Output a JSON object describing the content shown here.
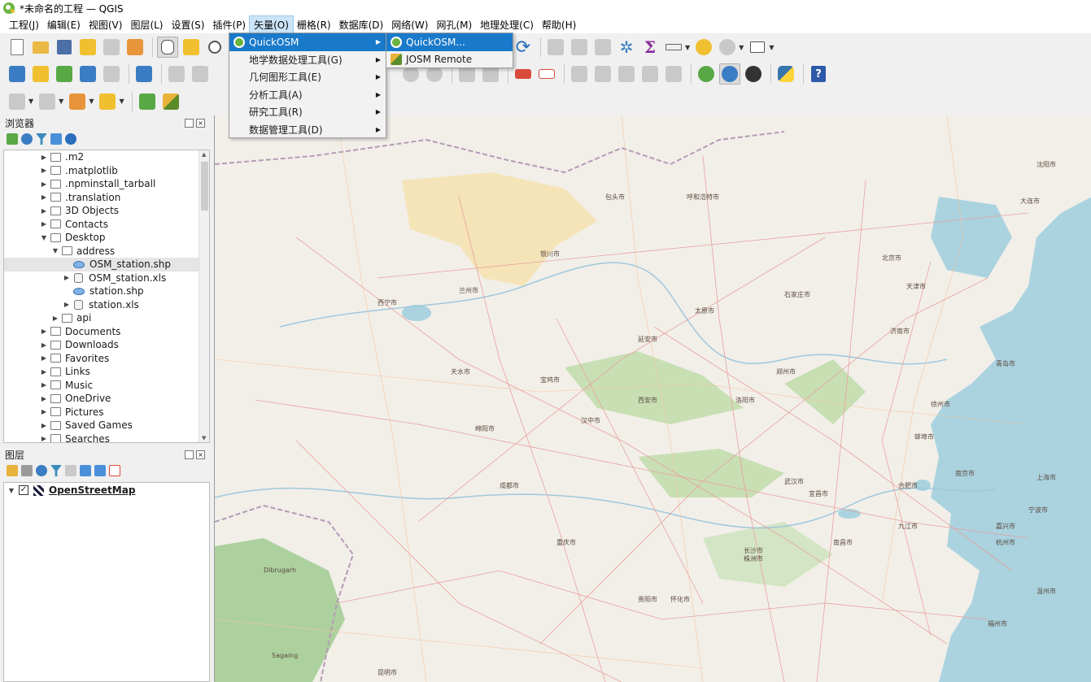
{
  "window": {
    "title": "*未命名的工程 — QGIS"
  },
  "menubar": {
    "items": [
      "工程(J)",
      "编辑(E)",
      "视图(V)",
      "图层(L)",
      "设置(S)",
      "插件(P)",
      "矢量(O)",
      "栅格(R)",
      "数据库(D)",
      "网络(W)",
      "网孔(M)",
      "地理处理(C)",
      "帮助(H)"
    ],
    "active_index": 6
  },
  "vector_menu": {
    "items": [
      {
        "label": "QuickOSM",
        "submenu": true,
        "highlighted": true
      },
      {
        "label": "地学数据处理工具(G)",
        "submenu": true
      },
      {
        "label": "几何图形工具(E)",
        "submenu": true
      },
      {
        "label": "分析工具(A)",
        "submenu": true
      },
      {
        "label": "研究工具(R)",
        "submenu": true
      },
      {
        "label": "数据管理工具(D)",
        "submenu": true
      }
    ]
  },
  "quickosm_submenu": {
    "items": [
      {
        "label": "QuickOSM...",
        "highlighted": true,
        "icon": "quickosm-icon"
      },
      {
        "label": "JOSM Remote",
        "icon": "josm-icon"
      }
    ]
  },
  "browser": {
    "title": "浏览器",
    "tree": [
      {
        "label": ".m2",
        "type": "folder",
        "depth": 0,
        "expanded": false
      },
      {
        "label": ".matplotlib",
        "type": "folder",
        "depth": 0,
        "expanded": false
      },
      {
        "label": ".npminstall_tarball",
        "type": "folder",
        "depth": 0,
        "expanded": false
      },
      {
        "label": ".translation",
        "type": "folder",
        "depth": 0,
        "expanded": false
      },
      {
        "label": "3D Objects",
        "type": "folder",
        "depth": 0,
        "expanded": false
      },
      {
        "label": "Contacts",
        "type": "folder",
        "depth": 0,
        "expanded": false
      },
      {
        "label": "Desktop",
        "type": "folder",
        "depth": 0,
        "expanded": true
      },
      {
        "label": "address",
        "type": "folder",
        "depth": 1,
        "expanded": true
      },
      {
        "label": "OSM_station.shp",
        "type": "shp",
        "depth": 2,
        "selected": true
      },
      {
        "label": "OSM_station.xls",
        "type": "db",
        "depth": 2,
        "expanded": false
      },
      {
        "label": "station.shp",
        "type": "shp",
        "depth": 2
      },
      {
        "label": "station.xls",
        "type": "db",
        "depth": 2,
        "expanded": false
      },
      {
        "label": "api",
        "type": "folder",
        "depth": 1,
        "expanded": false
      },
      {
        "label": "Documents",
        "type": "folder",
        "depth": 0,
        "expanded": false
      },
      {
        "label": "Downloads",
        "type": "folder",
        "depth": 0,
        "expanded": false
      },
      {
        "label": "Favorites",
        "type": "folder",
        "depth": 0,
        "expanded": false
      },
      {
        "label": "Links",
        "type": "folder",
        "depth": 0,
        "expanded": false
      },
      {
        "label": "Music",
        "type": "folder",
        "depth": 0,
        "expanded": false
      },
      {
        "label": "OneDrive",
        "type": "folder",
        "depth": 0,
        "expanded": false
      },
      {
        "label": "Pictures",
        "type": "folder",
        "depth": 0,
        "expanded": false
      },
      {
        "label": "Saved Games",
        "type": "folder",
        "depth": 0,
        "expanded": false
      },
      {
        "label": "Searches",
        "type": "folder",
        "depth": 0,
        "expanded": false
      }
    ]
  },
  "layers": {
    "title": "图层",
    "items": [
      {
        "label": "OpenStreetMap",
        "checked": true
      }
    ]
  },
  "map_labels": [
    {
      "text": "北京市"
    },
    {
      "text": "天津市"
    },
    {
      "text": "石家庄市"
    },
    {
      "text": "太原市"
    },
    {
      "text": "济南市"
    },
    {
      "text": "郑州市"
    },
    {
      "text": "西安市"
    },
    {
      "text": "兰州市"
    },
    {
      "text": "银川市"
    },
    {
      "text": "呼和浩特市"
    },
    {
      "text": "武汉市"
    },
    {
      "text": "南京市"
    },
    {
      "text": "上海市"
    },
    {
      "text": "杭州市"
    },
    {
      "text": "合肥市"
    },
    {
      "text": "成都市"
    },
    {
      "text": "重庆市"
    },
    {
      "text": "长沙市"
    },
    {
      "text": "南昌市"
    },
    {
      "text": "贵阳市"
    },
    {
      "text": "福州市"
    },
    {
      "text": "青岛市"
    },
    {
      "text": "大连市"
    },
    {
      "text": "沈阳市"
    },
    {
      "text": "西宁市"
    },
    {
      "text": "包头市"
    },
    {
      "text": "洛阳市"
    },
    {
      "text": "宜昌市"
    },
    {
      "text": "徐州市"
    },
    {
      "text": "温州市"
    },
    {
      "text": "宁波市"
    },
    {
      "text": "昆明市"
    },
    {
      "text": "绵阳市"
    },
    {
      "text": "汉中市"
    },
    {
      "text": "宝鸡市"
    },
    {
      "text": "延安市"
    },
    {
      "text": "天水市"
    },
    {
      "text": "怀化市"
    },
    {
      "text": "株洲市"
    },
    {
      "text": "九江市"
    },
    {
      "text": "嘉兴市"
    },
    {
      "text": "蚌埠市"
    },
    {
      "text": "Dibrugarh"
    },
    {
      "text": "Sagaing"
    }
  ],
  "colors": {
    "menu_highlight": "#1979ca",
    "map_land": "#f2efe9",
    "map_sea": "#aad3df",
    "map_forest": "#add19e",
    "map_desert": "#f5e4b8"
  }
}
